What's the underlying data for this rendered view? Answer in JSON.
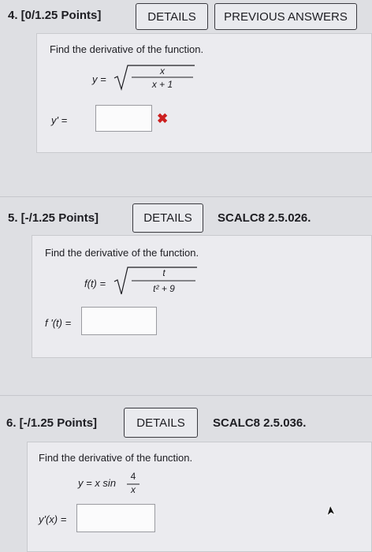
{
  "q4": {
    "points": "4. [0/1.25 Points]",
    "details_label": "DETAILS",
    "prev_answers_label": "PREVIOUS ANSWERS",
    "prompt": "Find the derivative of the function.",
    "eq_lhs": "y =",
    "frac_num": "x",
    "frac_den": "x + 1",
    "answer_label": "y' =",
    "answer_value": "",
    "status_mark": "✖"
  },
  "q5": {
    "points": "5. [-/1.25 Points]",
    "details_label": "DETAILS",
    "reference": "SCALC8 2.5.026.",
    "prompt": "Find the derivative of the function.",
    "eq_lhs": "f(t) =",
    "frac_num": "t",
    "frac_den": "t² + 9",
    "answer_label": "f '(t) =",
    "answer_value": ""
  },
  "q6": {
    "points": "6. [-/1.25 Points]",
    "details_label": "DETAILS",
    "reference": "SCALC8 2.5.036.",
    "prompt": "Find the derivative of the function.",
    "eq_lhs": "y = x sin",
    "frac_num": "4",
    "frac_den": "x",
    "answer_label": "y'(x) =",
    "answer_value": ""
  },
  "colors": {
    "page_bg": "#dedfe3",
    "panel_bg": "#ebebef",
    "incorrect_mark": "#cc1f1f",
    "button_border": "#3a3a40"
  },
  "icons": [
    "close-icon",
    "mouse-cursor-icon"
  ]
}
